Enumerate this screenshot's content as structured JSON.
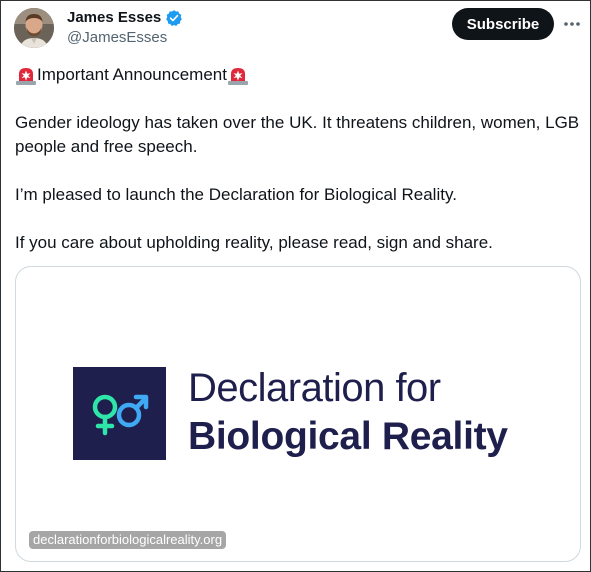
{
  "author": {
    "display_name": "James Esses",
    "handle": "@JamesEsses",
    "verified": true,
    "verified_color": "#1d9bf0"
  },
  "actions": {
    "subscribe_label": "Subscribe",
    "more_icon": "more-horizontal-icon"
  },
  "tweet": {
    "line1_text": "Important Announcement",
    "line1_emoji": "police-car-light-icon",
    "paragraph1": "Gender ideology has taken over the UK. It threatens children, women, LGB people and free speech.",
    "paragraph2": "I’m pleased to launch the Declaration for Biological Reality.",
    "paragraph3": "If you care about upholding reality, please read, sign and share."
  },
  "card": {
    "title_line1": "Declaration for",
    "title_line2": "Biological Reality",
    "domain": "declarationforbiologicalreality.org",
    "logo_icon": "venus-mars-icon",
    "brand_color": "#1f1f4d",
    "female_symbol_color": "#2ee6a8",
    "male_symbol_color": "#3fa9f5"
  }
}
